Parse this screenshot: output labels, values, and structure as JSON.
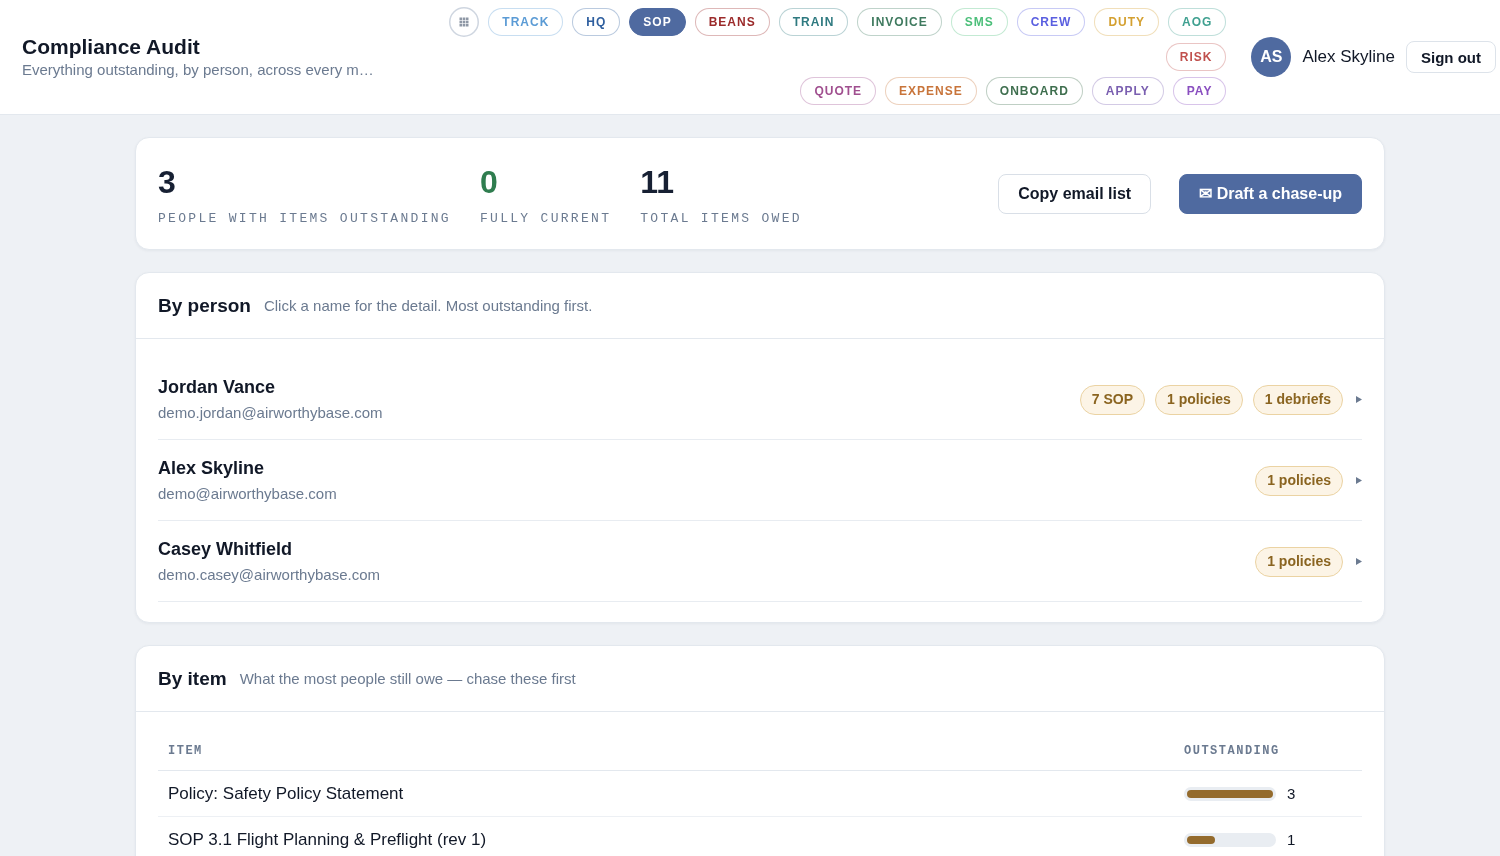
{
  "header": {
    "title": "Compliance Audit",
    "subtitle": "Everything outstanding, by person, across every m…"
  },
  "nav_groups": [
    {
      "items": [
        {
          "label": "TRACK",
          "color": "#5b9bd5",
          "selected": false
        },
        {
          "label": "HQ",
          "color": "#2f5f9f",
          "selected": false
        },
        {
          "label": "SOP",
          "color": "#4f6aa0",
          "selected": true
        },
        {
          "label": "BEANS",
          "color": "#9b2a2a",
          "selected": false
        },
        {
          "label": "TRAIN",
          "color": "#2f7a80",
          "selected": false
        },
        {
          "label": "INVOICE",
          "color": "#3f7a5f",
          "selected": false
        },
        {
          "label": "SMS",
          "color": "#4cbf7a",
          "selected": false
        },
        {
          "label": "CREW",
          "color": "#5a5fe0",
          "selected": false
        },
        {
          "label": "DUTY",
          "color": "#d4a030",
          "selected": false
        },
        {
          "label": "AOG",
          "color": "#3fa090",
          "selected": false
        }
      ]
    },
    {
      "items": [
        {
          "label": "RISK",
          "color": "#c0504d",
          "selected": false
        }
      ]
    },
    {
      "items": [
        {
          "label": "QUOTE",
          "color": "#a04f8f",
          "selected": false
        },
        {
          "label": "EXPENSE",
          "color": "#c8743a",
          "selected": false
        },
        {
          "label": "ONBOARD",
          "color": "#3f6f4f",
          "selected": false
        },
        {
          "label": "APPLY",
          "color": "#7a5fb0",
          "selected": false
        },
        {
          "label": "PAY",
          "color": "#8a4fc0",
          "selected": false
        }
      ]
    }
  ],
  "user": {
    "initials": "AS",
    "name": "Alex Skyline",
    "sign_out": "Sign out"
  },
  "summary": {
    "stats": [
      {
        "value": "3",
        "label": "PEOPLE WITH ITEMS OUTSTANDING",
        "kind": "neutral"
      },
      {
        "value": "0",
        "label": "FULLY CURRENT",
        "kind": "good"
      },
      {
        "value": "11",
        "label": "TOTAL ITEMS OWED",
        "kind": "neutral"
      }
    ],
    "buttons": [
      {
        "label": "Copy email list",
        "kind": "secondary"
      },
      {
        "label": "✉ Draft a chase-up",
        "kind": "primary"
      }
    ]
  },
  "by_person": {
    "title": "By person",
    "hint": "Click a name for the detail. Most outstanding first.",
    "people": [
      {
        "name": "Jordan Vance",
        "email": "demo.jordan@airworthybase.com",
        "badges": [
          "7 SOP",
          "1 policies",
          "1 debriefs"
        ]
      },
      {
        "name": "Alex Skyline",
        "email": "demo@airworthybase.com",
        "badges": [
          "1 policies"
        ]
      },
      {
        "name": "Casey Whitfield",
        "email": "demo.casey@airworthybase.com",
        "badges": [
          "1 policies"
        ]
      }
    ]
  },
  "by_item": {
    "title": "By item",
    "hint": "What the most people still owe — chase these first",
    "columns": [
      "ITEM",
      "OUTSTANDING"
    ],
    "rows": [
      {
        "item": "Policy: Safety Policy Statement",
        "level": 1,
        "count": "3"
      },
      {
        "item": "SOP 3.1 Flight Planning & Preflight (rev 1)",
        "level": 0.33,
        "count": "1"
      }
    ]
  }
}
